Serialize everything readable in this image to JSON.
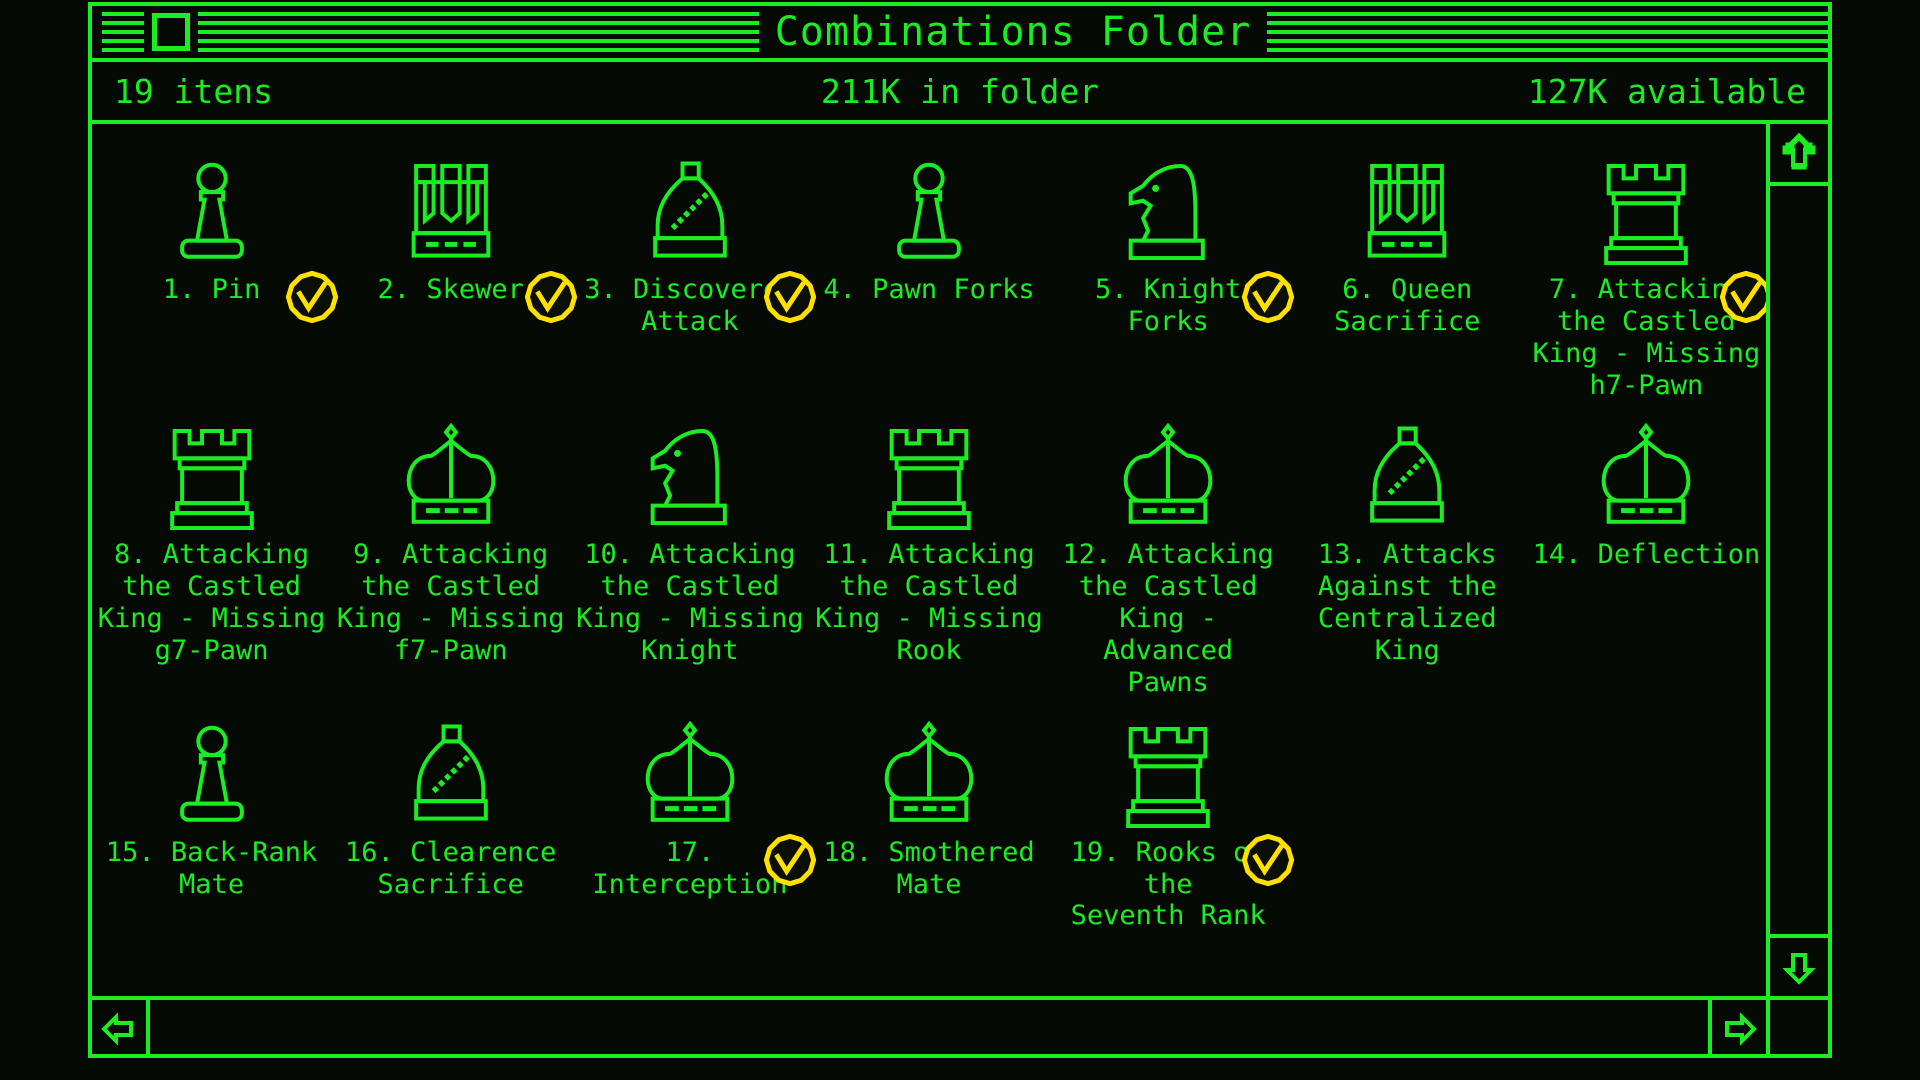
{
  "window": {
    "title": "Combinations Folder",
    "close_box": "close-box"
  },
  "info": {
    "items": "19 itens",
    "folder_size": "211K in folder",
    "available": "127K available"
  },
  "colors": {
    "green": "#1aee22",
    "yellow": "#ffe000",
    "background": "#050a05"
  },
  "scrollbars": {
    "up_arrow": "scroll-up-arrow",
    "down_arrow": "scroll-down-arrow",
    "left_arrow": "scroll-left-arrow",
    "right_arrow": "scroll-right-arrow"
  },
  "items": [
    {
      "label": "1. Pin",
      "piece": "pawn",
      "checked": true
    },
    {
      "label": "2. Skewer",
      "piece": "queen",
      "checked": true
    },
    {
      "label": "3. Discovered\nAttack",
      "piece": "bishop",
      "checked": true
    },
    {
      "label": "4. Pawn Forks",
      "piece": "pawn",
      "checked": false
    },
    {
      "label": "5. Knight Forks",
      "piece": "knight",
      "checked": true
    },
    {
      "label": "6. Queen\nSacrifice",
      "piece": "queen",
      "checked": false
    },
    {
      "label": "7. Attacking\nthe Castled\nKing - Missing\nh7-Pawn",
      "piece": "rook",
      "checked": true
    },
    {
      "label": "8. Attacking\nthe Castled\nKing - Missing\ng7-Pawn",
      "piece": "rook",
      "checked": false
    },
    {
      "label": "9. Attacking\nthe Castled\nKing - Missing\nf7-Pawn",
      "piece": "king",
      "checked": false
    },
    {
      "label": "10. Attacking\nthe Castled\nKing - Missing\nKnight",
      "piece": "knight",
      "checked": false
    },
    {
      "label": "11. Attacking\nthe Castled\nKing - Missing\nRook",
      "piece": "rook",
      "checked": false
    },
    {
      "label": "12. Attacking\nthe Castled\nKing - Advanced\nPawns",
      "piece": "king",
      "checked": false
    },
    {
      "label": "13. Attacks\nAgainst the\nCentralized\nKing",
      "piece": "bishop",
      "checked": false
    },
    {
      "label": "14. Deflection",
      "piece": "king",
      "checked": false
    },
    {
      "label": "15. Back-Rank\nMate",
      "piece": "pawn",
      "checked": false
    },
    {
      "label": "16. Clearence\nSacrifice",
      "piece": "bishop",
      "checked": false
    },
    {
      "label": "17.\nInterception",
      "piece": "king",
      "checked": true
    },
    {
      "label": "18. Smothered\nMate",
      "piece": "king",
      "checked": false
    },
    {
      "label": "19. Rooks on the\nSeventh Rank",
      "piece": "rook",
      "checked": true
    }
  ]
}
